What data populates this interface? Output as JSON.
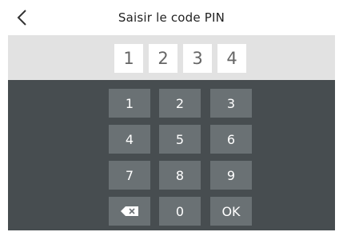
{
  "header": {
    "title": "Saisir le code PIN",
    "back_icon": "chevron-left-icon"
  },
  "pin": {
    "digits": [
      "1",
      "2",
      "3",
      "4"
    ]
  },
  "keypad": {
    "keys": [
      "1",
      "2",
      "3",
      "4",
      "5",
      "6",
      "7",
      "8",
      "9"
    ],
    "zero": "0",
    "ok": "OK",
    "backspace_icon": "backspace-icon"
  },
  "colors": {
    "pad": "#474d50",
    "key": "#6a7174",
    "pin_bar": "#e2e2e2"
  }
}
